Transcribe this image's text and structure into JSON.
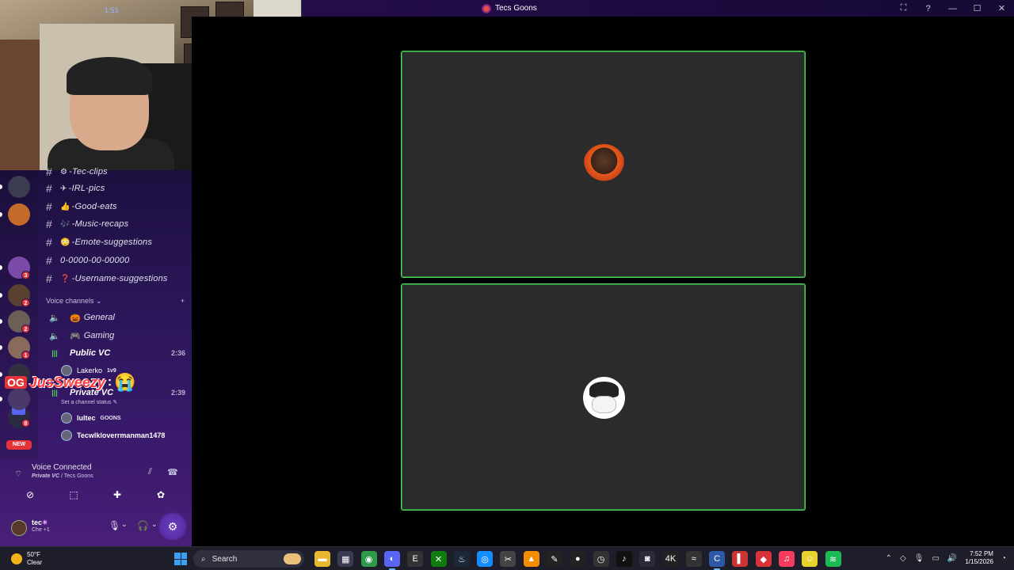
{
  "window": {
    "title": "Tecs Goons",
    "controls": [
      "⛶",
      "?",
      "—",
      "☐",
      "✕"
    ]
  },
  "webcam": {
    "clock": "1:53"
  },
  "server_rail": {
    "servers": [
      {
        "name": "server-1",
        "badge": "",
        "color": "#3c3c50"
      },
      {
        "name": "server-2",
        "badge": "",
        "color": "#c46a2a"
      },
      {
        "name": "server-3",
        "badge": "3",
        "color": "#7a4aa8"
      },
      {
        "name": "server-4",
        "badge": "2",
        "color": "#5a4030"
      },
      {
        "name": "server-5",
        "badge": "2",
        "color": "#6b5f58"
      },
      {
        "name": "server-6",
        "badge": "1",
        "color": "#8a6a5a"
      },
      {
        "name": "server-7",
        "badge": "",
        "color": "#303040"
      },
      {
        "name": "server-8",
        "badge": "",
        "color": "#4a3a6a"
      },
      {
        "name": "server-9",
        "badge": "8",
        "color": "#2a2a40"
      }
    ],
    "new_label": "NEW"
  },
  "channels": {
    "text": [
      {
        "emoji": "⚙",
        "name": "-Tec-clips"
      },
      {
        "emoji": "✈",
        "name": "-IRL-pics"
      },
      {
        "emoji": "👍",
        "name": "-Good-eats"
      },
      {
        "emoji": "🎶",
        "name": "-Music-recaps"
      },
      {
        "emoji": "😳",
        "name": "-Emote-suggestions"
      },
      {
        "emoji": "",
        "name": "0-0000-00-00000"
      },
      {
        "emoji": "❓",
        "name": "-Username-suggestions"
      }
    ],
    "voice_category": "Voice channels",
    "voice": [
      {
        "emoji": "🎃",
        "name": "General",
        "time": ""
      },
      {
        "emoji": "🎮",
        "name": "Gaming",
        "time": ""
      },
      {
        "emoji": "",
        "name": "Public VC",
        "time": "2:36"
      },
      {
        "emoji": "",
        "name": "Private VC",
        "time": "2:39"
      }
    ],
    "public_members": [
      {
        "name": "Lakerko",
        "tag": "1v9"
      }
    ],
    "private_status": "Set a channel status ✎",
    "private_members": [
      {
        "name": "lultec",
        "tag": "GOONS"
      },
      {
        "name": "Tecwlkloverrmanman1478",
        "tag": ""
      }
    ]
  },
  "overlay_chat": {
    "badge": "OG",
    "name": "JusSweezy",
    "colon": ":",
    "emoji": "😭"
  },
  "voice_panel": {
    "title": "Voice Connected",
    "channel": "Private VC",
    "server": " / Tecs Goons",
    "buttons": [
      "camera-off",
      "screen-share",
      "activities",
      "soundboard"
    ]
  },
  "user": {
    "name": "tec",
    "star": "✴",
    "status": "Che +1"
  },
  "participants": [
    {
      "name": "participant-1"
    },
    {
      "name": "participant-2"
    }
  ],
  "taskbar": {
    "weather_temp": "50°F",
    "weather_desc": "Clear",
    "search_label": "Search",
    "time": "7:52 PM",
    "date": "1/15/2026",
    "apps": [
      {
        "name": "file-explorer",
        "color": "#e8b82e",
        "glyph": "▬"
      },
      {
        "name": "store",
        "color": "#3a3a50",
        "glyph": "▦"
      },
      {
        "name": "chrome",
        "color": "#2e9b4a",
        "glyph": "◉"
      },
      {
        "name": "discord",
        "color": "#5865f2",
        "glyph": "◐"
      },
      {
        "name": "epic",
        "color": "#333",
        "glyph": "E"
      },
      {
        "name": "xbox",
        "color": "#107c10",
        "glyph": "✕"
      },
      {
        "name": "steam",
        "color": "#1b2838",
        "glyph": "♨"
      },
      {
        "name": "battlenet",
        "color": "#148eff",
        "glyph": "◎"
      },
      {
        "name": "capcut",
        "color": "#444",
        "glyph": "✂"
      },
      {
        "name": "vlc",
        "color": "#f28c00",
        "glyph": "▲"
      },
      {
        "name": "pen",
        "color": "#222",
        "glyph": "✎"
      },
      {
        "name": "obs",
        "color": "#222",
        "glyph": "●"
      },
      {
        "name": "clock",
        "color": "#333",
        "glyph": "◷"
      },
      {
        "name": "tiktok",
        "color": "#111",
        "glyph": "♪"
      },
      {
        "name": "app-15",
        "color": "#2a2a3a",
        "glyph": "◙"
      },
      {
        "name": "app-16",
        "color": "#222",
        "glyph": "4K"
      },
      {
        "name": "app-17",
        "color": "#333",
        "glyph": "≈"
      },
      {
        "name": "app-18",
        "color": "#2d5aa8",
        "glyph": "C"
      },
      {
        "name": "app-19",
        "color": "#c33",
        "glyph": "▌"
      },
      {
        "name": "app-20",
        "color": "#d9333a",
        "glyph": "◆"
      },
      {
        "name": "itunes",
        "color": "#f43c5c",
        "glyph": "♫"
      },
      {
        "name": "app-22",
        "color": "#e8d22e",
        "glyph": "☺"
      },
      {
        "name": "spotify",
        "color": "#1db954",
        "glyph": "≋"
      }
    ]
  }
}
